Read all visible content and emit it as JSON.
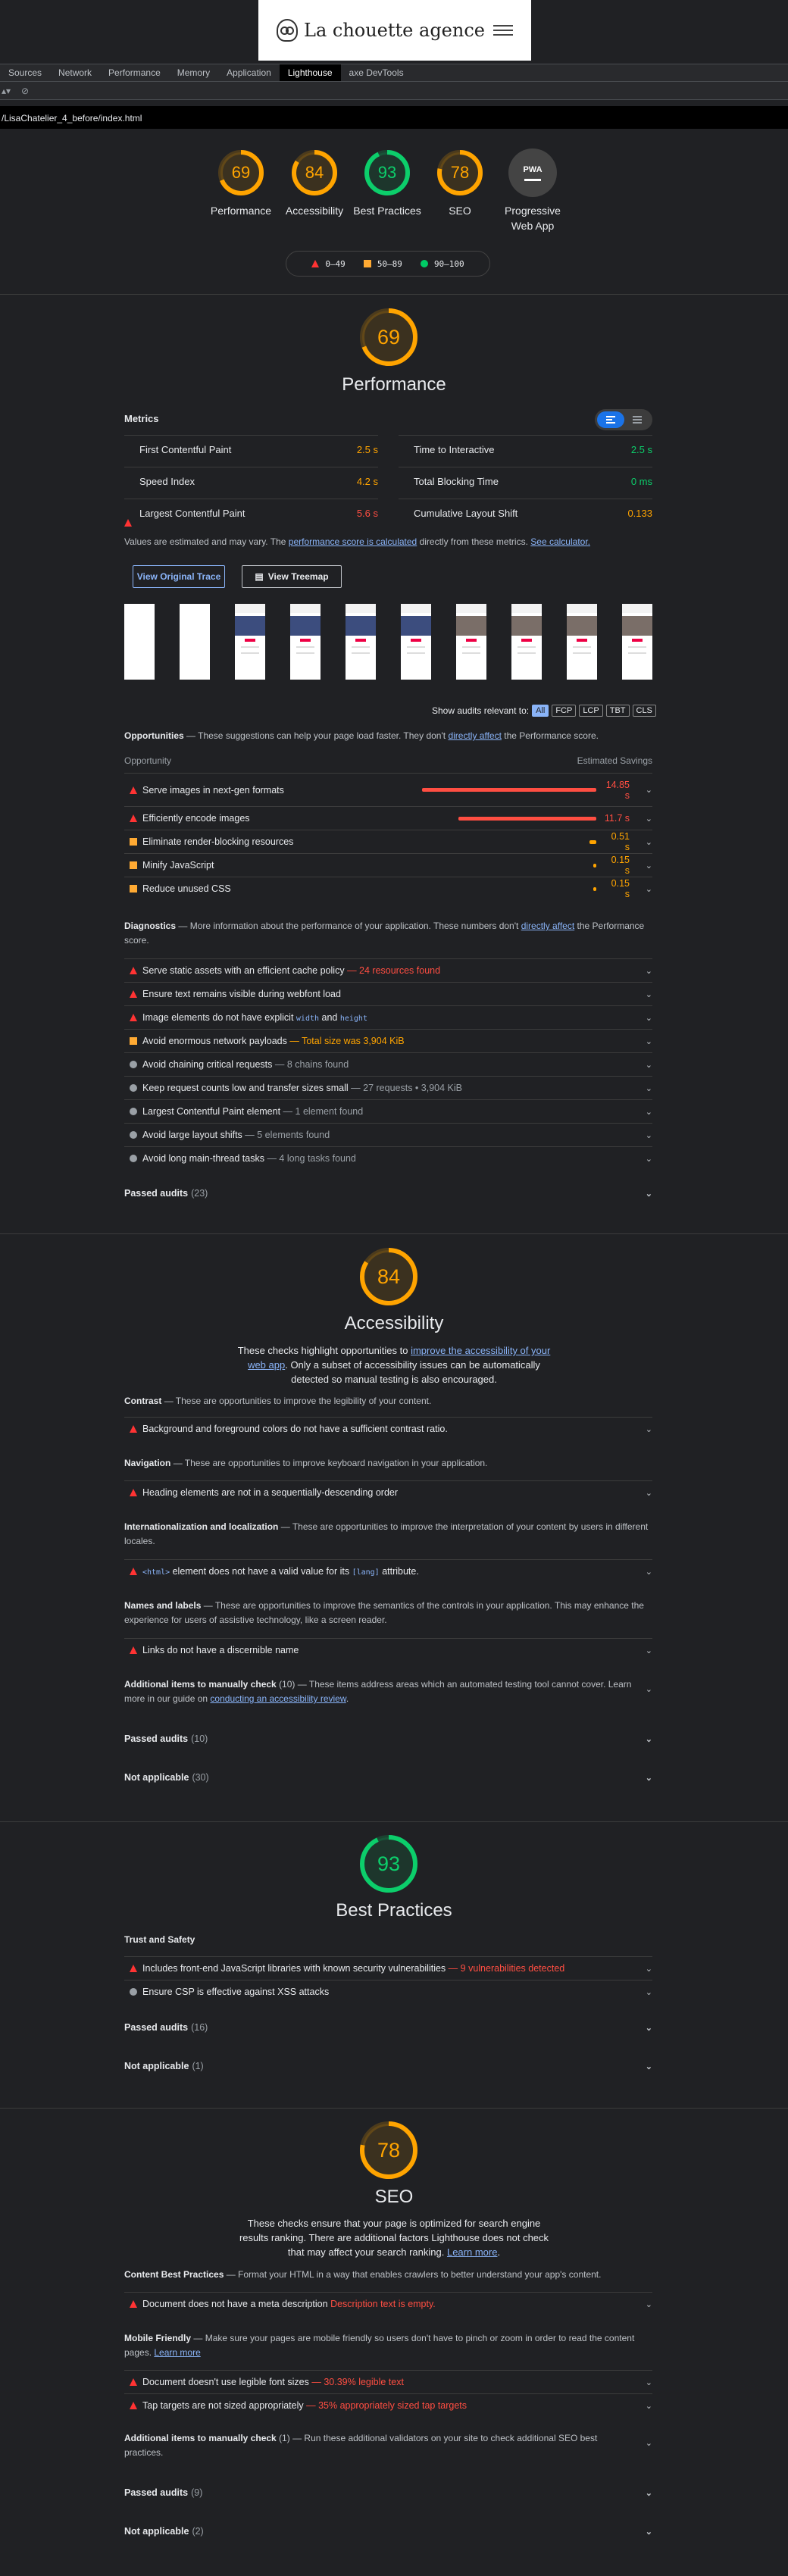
{
  "site": {
    "brand": "La chouette agence"
  },
  "devtools": {
    "tabs": [
      "Sources",
      "Network",
      "Performance",
      "Memory",
      "Application",
      "Lighthouse",
      "axe DevTools"
    ],
    "active_tab": "Lighthouse",
    "url": "/LisaChatelier_4_before/index.html"
  },
  "colors": {
    "fail": "#ff4e42",
    "average": "#ffa400",
    "pass": "#0cce6b"
  },
  "summary_gauges": [
    {
      "score": "69",
      "label": "Performance",
      "color": "#ffa400"
    },
    {
      "score": "84",
      "label": "Accessibility",
      "color": "#ffa400"
    },
    {
      "score": "93",
      "label": "Best Practices",
      "color": "#0cce6b"
    },
    {
      "score": "78",
      "label": "SEO",
      "color": "#ffa400"
    },
    {
      "score": "PWA",
      "label": "Progressive Web App",
      "color": "#9aa0a6"
    }
  ],
  "legend": [
    "0–49",
    "50–89",
    "90–100"
  ],
  "performance": {
    "score": "69",
    "title": "Performance",
    "metrics_title": "Metrics",
    "metrics": [
      {
        "label": "First Contentful Paint",
        "value": "2.5 s",
        "status": "average"
      },
      {
        "label": "Time to Interactive",
        "value": "2.5 s",
        "status": "pass"
      },
      {
        "label": "Speed Index",
        "value": "4.2 s",
        "status": "average"
      },
      {
        "label": "Total Blocking Time",
        "value": "0 ms",
        "status": "pass"
      },
      {
        "label": "Largest Contentful Paint",
        "value": "5.6 s",
        "status": "fail"
      },
      {
        "label": "Cumulative Layout Shift",
        "value": "0.133",
        "status": "average"
      }
    ],
    "note_prefix": "Values are estimated and may vary. The",
    "note_link1": "performance score is calculated",
    "note_mid": "directly from these metrics.",
    "note_link2": "See calculator.",
    "btn_trace": "View Original Trace",
    "btn_treemap": "View Treemap",
    "show_audits": "Show audits relevant to:",
    "filters": [
      "All",
      "FCP",
      "LCP",
      "TBT",
      "CLS"
    ],
    "opp_heading": "Opportunities",
    "opp_desc": "— These suggestions can help your page load faster. They don't",
    "opp_link": "directly affect",
    "opp_desc2": "the Performance score.",
    "opp_col1": "Opportunity",
    "opp_col2": "Estimated Savings",
    "opportunities": [
      {
        "title": "Serve images in next-gen formats",
        "savings": "14.85 s",
        "fraction": 1.0,
        "status": "fail"
      },
      {
        "title": "Efficiently encode images",
        "savings": "11.7 s",
        "fraction": 0.79,
        "status": "fail"
      },
      {
        "title": "Eliminate render-blocking resources",
        "savings": "0.51 s",
        "fraction": 0.04,
        "status": "average"
      },
      {
        "title": "Minify JavaScript",
        "savings": "0.15 s",
        "fraction": 0.01,
        "status": "average"
      },
      {
        "title": "Reduce unused CSS",
        "savings": "0.15 s",
        "fraction": 0.01,
        "status": "average"
      }
    ],
    "diag_heading": "Diagnostics",
    "diag_desc": "— More information about the performance of your application. These numbers don't",
    "diag_link": "directly affect",
    "diag_desc2": "the Performance score.",
    "diagnostics": [
      {
        "title": "Serve static assets with an efficient cache policy",
        "extra": "— 24 resources found",
        "status": "fail",
        "tone": "red"
      },
      {
        "title": "Ensure text remains visible during webfont load",
        "extra": "",
        "status": "fail",
        "tone": ""
      },
      {
        "title": "Image elements do not have explicit",
        "code1": "width",
        "and": "and",
        "code2": "height",
        "status": "fail",
        "tone": ""
      },
      {
        "title": "Avoid enormous network payloads",
        "extra": "— Total size was 3,904 KiB",
        "status": "average",
        "tone": "orange"
      },
      {
        "title": "Avoid chaining critical requests",
        "extra": "— 8 chains found",
        "status": "info",
        "tone": ""
      },
      {
        "title": "Keep request counts low and transfer sizes small",
        "extra": "— 27 requests • 3,904 KiB",
        "status": "info",
        "tone": ""
      },
      {
        "title": "Largest Contentful Paint element",
        "extra": "— 1 element found",
        "status": "info",
        "tone": ""
      },
      {
        "title": "Avoid large layout shifts",
        "extra": "— 5 elements found",
        "status": "info",
        "tone": ""
      },
      {
        "title": "Avoid long main-thread tasks",
        "extra": "— 4 long tasks found",
        "status": "info",
        "tone": ""
      }
    ],
    "passed": "Passed audits",
    "passed_count": "(23)"
  },
  "accessibility": {
    "score": "84",
    "title": "Accessibility",
    "desc1": "These checks highlight opportunities to",
    "desc_link": "improve the accessibility of your web app",
    "desc2": ". Only a subset of accessibility issues can be automatically detected so manual testing is also encouraged.",
    "contrast_h": "Contrast",
    "contrast_d": "— These are opportunities to improve the legibility of your content.",
    "contrast_a": "Background and foreground colors do not have a sufficient contrast ratio.",
    "nav_h": "Navigation",
    "nav_d": "— These are opportunities to improve keyboard navigation in your application.",
    "nav_a": "Heading elements are not in a sequentially-descending order",
    "intl_h": "Internationalization and localization",
    "intl_d": "— These are opportunities to improve the interpretation of your content by users in different locales.",
    "intl_code": "<html>",
    "intl_a1": "element does not have a valid value for its",
    "intl_code2": "[lang]",
    "intl_a2": "attribute.",
    "names_h": "Names and labels",
    "names_d": "— These are opportunities to improve the semantics of the controls in your application. This may enhance the experience for users of assistive technology, like a screen reader.",
    "names_a": "Links do not have a discernible name",
    "manual_h": "Additional items to manually check",
    "manual_count": "(10)",
    "manual_d": "— These items address areas which an automated testing tool cannot cover. Learn more in our guide on",
    "manual_link": "conducting an accessibility review",
    "passed": "Passed audits",
    "passed_count": "(10)",
    "na": "Not applicable",
    "na_count": "(30)"
  },
  "best_practices": {
    "score": "93",
    "title": "Best Practices",
    "trust_h": "Trust and Safety",
    "a1": "Includes front-end JavaScript libraries with known security vulnerabilities",
    "a1_extra": "— 9 vulnerabilities detected",
    "a2": "Ensure CSP is effective against XSS attacks",
    "passed": "Passed audits",
    "passed_count": "(16)",
    "na": "Not applicable",
    "na_count": "(1)"
  },
  "seo": {
    "score": "78",
    "title": "SEO",
    "desc": "These checks ensure that your page is optimized for search engine results ranking. There are additional factors Lighthouse does not check that may affect your search ranking.",
    "desc_link": "Learn more",
    "cbp_h": "Content Best Practices",
    "cbp_d": "— Format your HTML in a way that enables crawlers to better understand your app's content.",
    "cbp_a": "Document does not have a meta description",
    "cbp_a_extra": "Description text is empty.",
    "mob_h": "Mobile Friendly",
    "mob_d": "— Make sure your pages are mobile friendly so users don't have to pinch or zoom in order to read the content pages.",
    "mob_link": "Learn more",
    "mob_a1": "Document doesn't use legible font sizes",
    "mob_a1_extra": "— 30.39% legible text",
    "mob_a2": "Tap targets are not sized appropriately",
    "mob_a2_extra": "— 35% appropriately sized tap targets",
    "manual_h": "Additional items to manually check",
    "manual_count": "(1)",
    "manual_d": "— Run these additional validators on your site to check additional SEO best practices.",
    "passed": "Passed audits",
    "passed_count": "(9)",
    "na": "Not applicable",
    "na_count": "(2)"
  }
}
